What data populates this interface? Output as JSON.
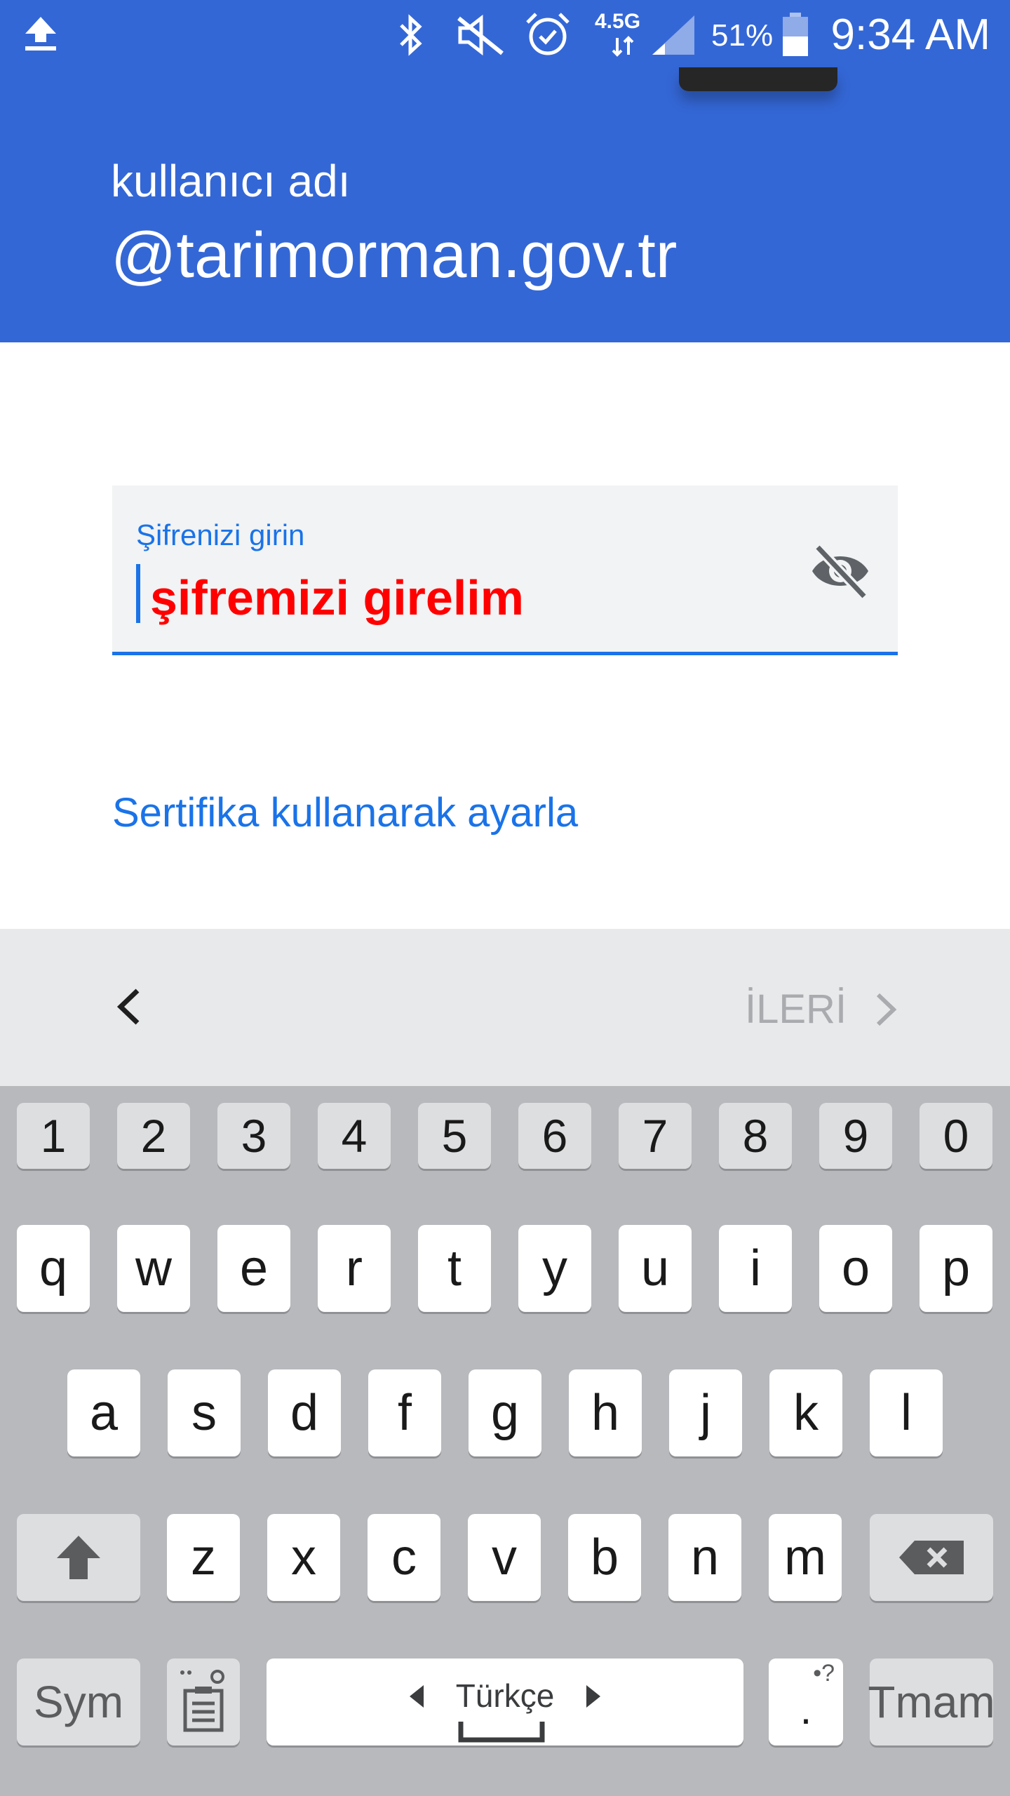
{
  "status_bar": {
    "time": "9:34 AM",
    "battery": "51%",
    "network": "4.5G",
    "icons": [
      "upload-icon",
      "bluetooth-icon",
      "mute-icon",
      "alarm-icon",
      "signal-icon",
      "battery-icon"
    ]
  },
  "header": {
    "label": "kullanıcı adı",
    "domain": "@tarimorman.gov.tr",
    "bg_color": "#3467d6"
  },
  "password_field": {
    "label": "Şifrenizi girin",
    "value": "şifremizi girelim",
    "visibility_icon": "eye-off-icon",
    "accent_color": "#1a73e8"
  },
  "cert_link": "Sertifika kullanarak ayarla",
  "nav": {
    "back_icon": "chevron-left-icon",
    "next_label": "İLERİ",
    "next_icon": "chevron-right-icon"
  },
  "keyboard": {
    "number_row": [
      "1",
      "2",
      "3",
      "4",
      "5",
      "6",
      "7",
      "8",
      "9",
      "0"
    ],
    "row1": [
      "q",
      "w",
      "e",
      "r",
      "t",
      "y",
      "u",
      "i",
      "o",
      "p"
    ],
    "row2": [
      "a",
      "s",
      "d",
      "f",
      "g",
      "h",
      "j",
      "k",
      "l"
    ],
    "row3": [
      "z",
      "x",
      "c",
      "v",
      "b",
      "n",
      "m"
    ],
    "sym_label": "Sym",
    "language_label": "Türkçe",
    "period_label": ".",
    "period_hint": "•?",
    "done_label": "Tmam"
  }
}
